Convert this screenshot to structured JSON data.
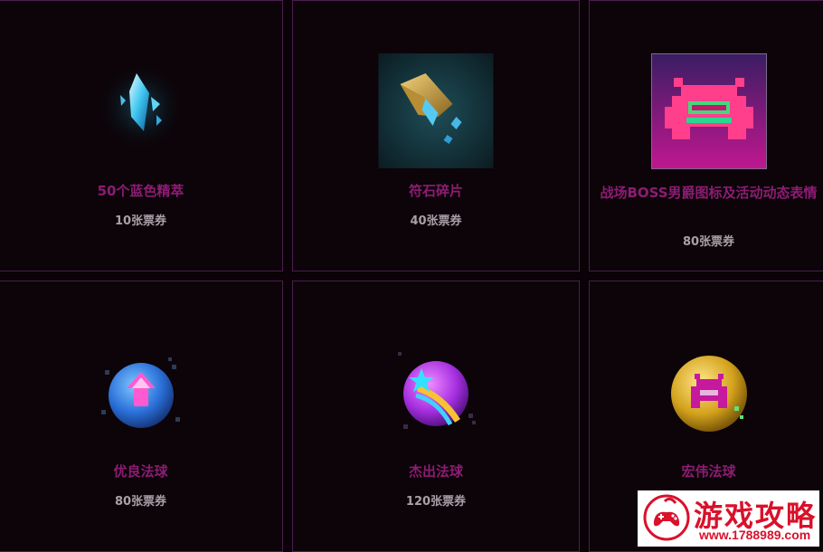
{
  "rewards": [
    {
      "name": "50个蓝色精萃",
      "price": "10张票券",
      "icon": "blue-essence-crystal-icon"
    },
    {
      "name": "符石碎片",
      "price": "40张票券",
      "icon": "rune-shard-icon"
    },
    {
      "name": "战场BOSS男爵图标及活动动态表情",
      "price": "80张票券",
      "icon": "boss-space-invader-icon"
    },
    {
      "name": "优良法球",
      "price": "80张票券",
      "icon": "blue-orb-icon"
    },
    {
      "name": "杰出法球",
      "price": "120张票券",
      "icon": "purple-orb-icon"
    },
    {
      "name": "宏伟法球",
      "price": "",
      "icon": "gold-orb-icon"
    }
  ],
  "watermark": {
    "title": "游戏攻略",
    "url": "www.1788989.com"
  },
  "colors": {
    "background": "#0a0206",
    "border": "#4a1f4e",
    "name": "#8d1c73",
    "price": "#a7a0a6",
    "watermark": "#d9112b"
  }
}
